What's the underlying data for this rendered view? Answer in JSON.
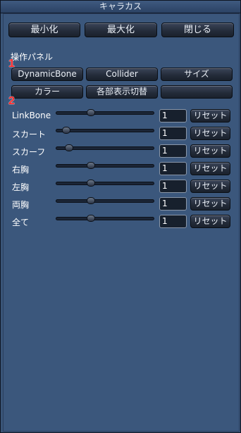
{
  "window": {
    "title": "キャラカス"
  },
  "top_buttons": {
    "minimize": "最小化",
    "maximize": "最大化",
    "close": "閉じる"
  },
  "panel": {
    "heading": "操作パネル",
    "buttons": [
      "DynamicBone",
      "Collider",
      "サイズ",
      "カラー",
      "各部表示切替",
      ""
    ]
  },
  "markers": [
    "1",
    "2"
  ],
  "sliders": [
    {
      "label": "LinkBone",
      "position": 0.35,
      "value": "1",
      "reset": "リセット"
    },
    {
      "label": "スカート",
      "position": 0.1,
      "value": "1",
      "reset": "リセット"
    },
    {
      "label": "スカーフ",
      "position": 0.13,
      "value": "1",
      "reset": "リセット"
    },
    {
      "label": "右胸",
      "position": 0.35,
      "value": "1",
      "reset": "リセット"
    },
    {
      "label": "左胸",
      "position": 0.35,
      "value": "1",
      "reset": "リセット"
    },
    {
      "label": "両胸",
      "position": 0.35,
      "value": "1",
      "reset": "リセット"
    },
    {
      "label": "全て",
      "position": 0.35,
      "value": "1",
      "reset": "リセット"
    }
  ]
}
